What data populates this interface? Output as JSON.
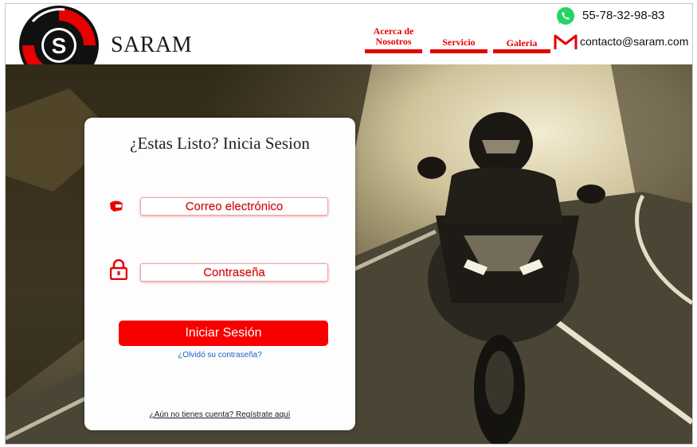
{
  "header": {
    "brand": "SARAM",
    "logo_letter": "S",
    "nav": [
      {
        "label_line1": "Acerca de",
        "label_line2": "Nosotros"
      },
      {
        "label": "Servicio"
      },
      {
        "label": "Galeria"
      }
    ],
    "phone": "55-78-32-98-83",
    "email": "contacto@saram.com"
  },
  "login": {
    "title": "¿Estas Listo? Inicia Sesion",
    "email_label": "Correo electrónico",
    "password_label": "Contraseña",
    "submit_label": "Iniciar Sesión",
    "forgot_link": "¿Olvidó su contraseña?",
    "register_link": "¿Aún no tienes cuenta? Regístrate aquí"
  },
  "colors": {
    "accent": "#e60000",
    "whatsapp": "#25d366",
    "link": "#1f5fbf"
  },
  "icons": {
    "phone": "whatsapp-icon",
    "email": "gmail-icon",
    "email_field": "helmet-icon",
    "password_field": "lock-icon"
  }
}
